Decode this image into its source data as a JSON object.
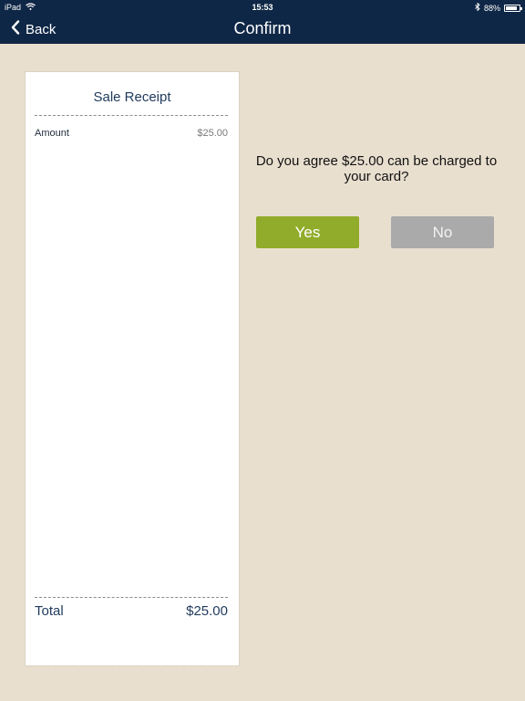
{
  "status_bar": {
    "device": "iPad",
    "time": "15:53",
    "battery_percent": "88%",
    "battery_level": 0.88,
    "icons": [
      "wifi-icon",
      "bluetooth-icon",
      "battery-icon"
    ]
  },
  "nav": {
    "back_label": "Back",
    "title": "Confirm"
  },
  "receipt": {
    "title": "Sale Receipt",
    "items": [
      {
        "label": "Amount",
        "value": "$25.00"
      }
    ],
    "total_label": "Total",
    "total_value": "$25.00"
  },
  "confirm": {
    "question": "Do you agree $25.00 can be charged to your card?",
    "yes_label": "Yes",
    "no_label": "No"
  },
  "colors": {
    "nav_background": "#0f2746",
    "page_background": "#e9dfcf",
    "yes_button": "#91ac2a",
    "no_button": "#aaaaaa",
    "receipt_text": "#1f3a5c"
  }
}
